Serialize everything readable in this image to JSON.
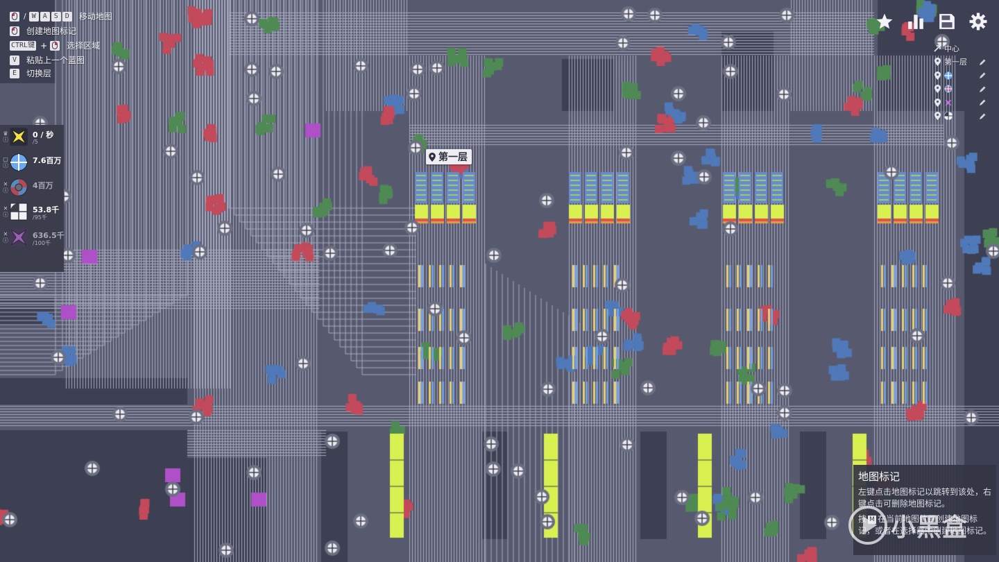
{
  "help": {
    "move_keys": [
      "W",
      "A",
      "S",
      "D"
    ],
    "move_label": "移动地图",
    "marker_label": "创建地图标记",
    "ctrl_key": "CTRL键",
    "select_label": "选择区域",
    "v_key": "V",
    "paste_label": "粘贴上一个蓝图",
    "e_key": "E",
    "layer_label": "切换层"
  },
  "stats": [
    {
      "value": "0 / 秒",
      "sub": "/5",
      "icon": "goal-shape-icon",
      "color": "#f4e24a"
    },
    {
      "value": "7.6百万",
      "sub": "",
      "icon": "circle-shape-icon",
      "color": "#6aa8f0"
    },
    {
      "value": "4百万",
      "sub": "",
      "icon": "wind-shape-icon",
      "color": "#e05060"
    },
    {
      "value": "53.8千",
      "sub": "/95千",
      "icon": "square-shape-icon",
      "color": "#f2f2f6"
    },
    {
      "value": "636.5千",
      "sub": "/100千",
      "icon": "star-shape-icon",
      "color": "#c070e0"
    }
  ],
  "toolbar": {
    "favorites": "star-icon",
    "statistics": "bar-chart-icon",
    "save": "save-icon",
    "settings": "gear-icon"
  },
  "waypoints": [
    {
      "label": "中心",
      "icon": "arrow-icon"
    },
    {
      "label": "第一层",
      "icon": "pin-icon"
    },
    {
      "label": "",
      "icon": "circle-shape-icon",
      "color": "#6aa8f0"
    },
    {
      "label": "",
      "icon": "target-shape-icon",
      "color": "#e05060"
    },
    {
      "label": "",
      "icon": "star-shape-icon",
      "color": "#c070e0"
    },
    {
      "label": "",
      "icon": "square-shape-icon",
      "color": "#f2f2f6"
    }
  ],
  "map_marker": {
    "label": "第一层"
  },
  "tooltip": {
    "title": "地图标记",
    "body": "左键点击地图标记以跳转到该处，右键点击可删除地图标记。",
    "hint_before": "按",
    "hint_key": "M",
    "hint_after": "在当前地图位置创建地图标记，或者在选择器中创建地图标记。"
  },
  "watermark": {
    "text": "小黑盒"
  },
  "colors": {
    "background": "#575a6e",
    "belt": "#a8abc0",
    "building": "#3d3f52",
    "panel": "#3b3d4d",
    "accent_yellow": "#d8f050",
    "resource_red": "#c24a5a",
    "resource_blue": "#4f79b8",
    "resource_green": "#4f8a55",
    "resource_purple": "#b050c8"
  }
}
